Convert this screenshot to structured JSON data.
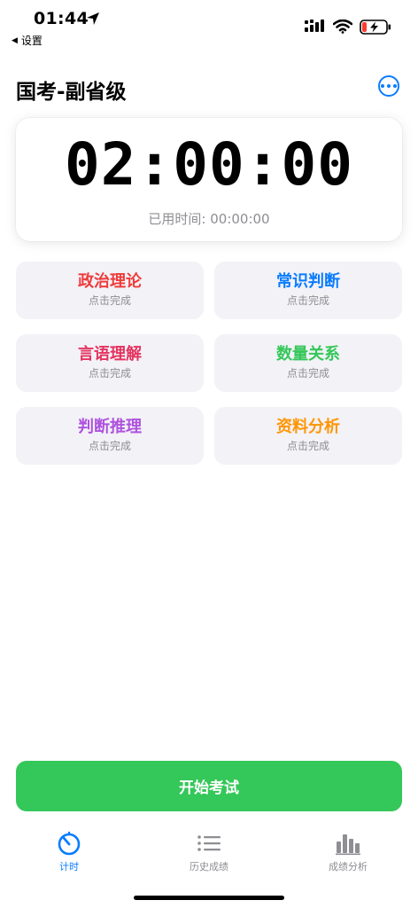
{
  "status_bar": {
    "time": "01:44",
    "back_label": "设置",
    "back_arrow": "◀"
  },
  "header": {
    "title": "国考-副省级",
    "more_icon": "ellipsis-circle-icon"
  },
  "timer": {
    "display": "02:00:00",
    "elapsed_label": "已用时间:",
    "elapsed_value": "00:00:00"
  },
  "subjects": [
    {
      "name": "政治理论",
      "status": "点击完成",
      "color": "#ef3b3b"
    },
    {
      "name": "常识判断",
      "status": "点击完成",
      "color": "#0a7cff"
    },
    {
      "name": "言语理解",
      "status": "点击完成",
      "color": "#e5335f"
    },
    {
      "name": "数量关系",
      "status": "点击完成",
      "color": "#34c759"
    },
    {
      "name": "判断推理",
      "status": "点击完成",
      "color": "#af52de"
    },
    {
      "name": "资料分析",
      "status": "点击完成",
      "color": "#ff9500"
    }
  ],
  "start_button": {
    "label": "开始考试",
    "color": "#34c759"
  },
  "tabs": [
    {
      "label": "计时",
      "icon": "timer-icon",
      "active": true
    },
    {
      "label": "历史成绩",
      "icon": "list-icon",
      "active": false
    },
    {
      "label": "成绩分析",
      "icon": "bar-chart-icon",
      "active": false
    }
  ],
  "colors": {
    "accent": "#0a7cff",
    "secondary_text": "#8e8e93",
    "card_bg": "#f2f2f7"
  }
}
